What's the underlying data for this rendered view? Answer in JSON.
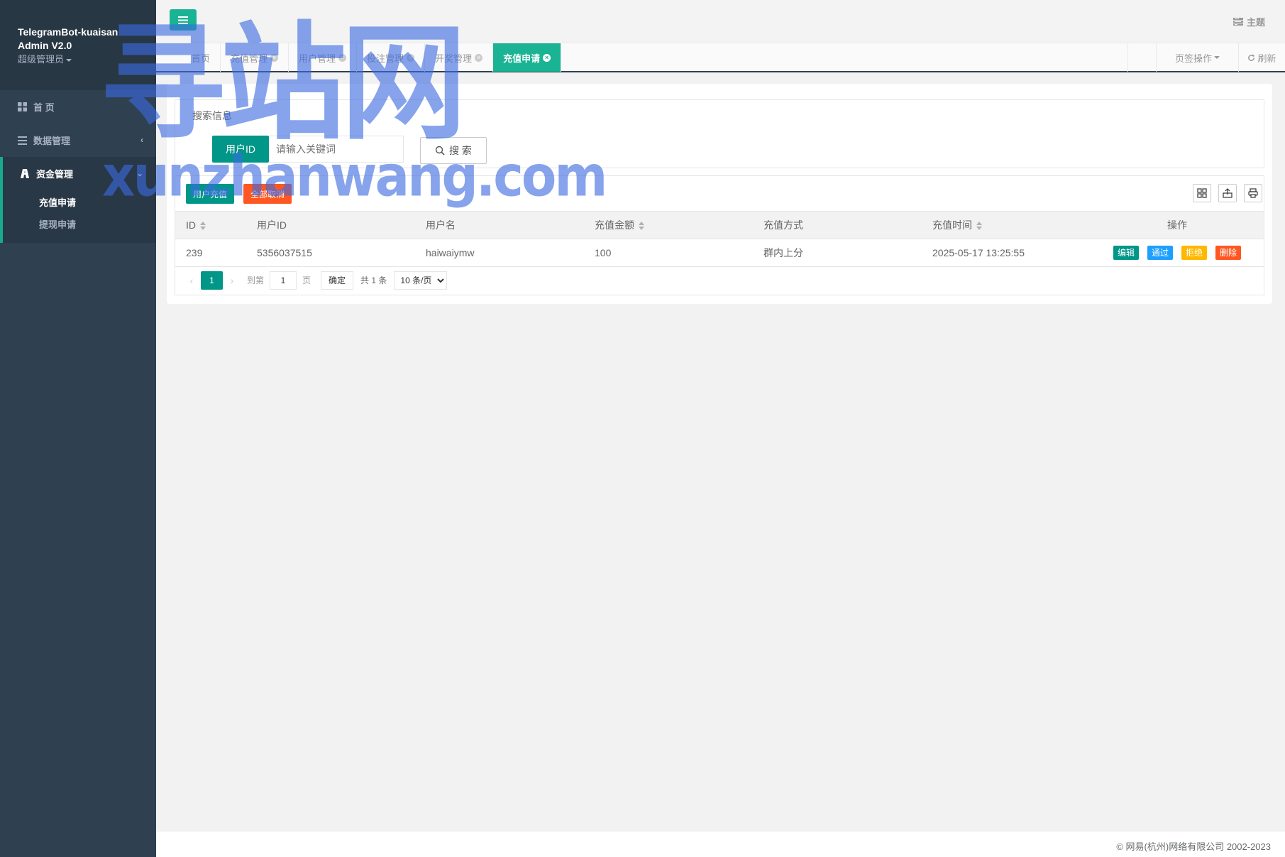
{
  "brand": {
    "title_line1": "TelegramBot-kuaisan",
    "title_line2": "Admin V2.0",
    "role": "超级管理员"
  },
  "sidebar": {
    "items": [
      {
        "label": "首 页"
      },
      {
        "label": "数据管理"
      },
      {
        "label": "资金管理"
      }
    ],
    "sub_items": [
      {
        "label": "充值申请",
        "active": true
      },
      {
        "label": "提现申请",
        "active": false
      }
    ]
  },
  "topbar": {
    "theme_label": "主题"
  },
  "tabs": [
    {
      "label": "首页",
      "closable": false
    },
    {
      "label": "充值管理",
      "closable": true
    },
    {
      "label": "用户管理",
      "closable": true
    },
    {
      "label": "投注管理",
      "closable": true
    },
    {
      "label": "开奖管理",
      "closable": true
    },
    {
      "label": "充值申请",
      "closable": true,
      "active": true
    }
  ],
  "tab_actions": {
    "ops_label": "页签操作",
    "refresh_label": "刷新"
  },
  "search": {
    "title": "搜索信息",
    "field_label": "用户ID",
    "placeholder": "请输入关键词",
    "button_label": "搜 索"
  },
  "toolbar": {
    "recharge_label": "用户充值",
    "cancel_all_label": "全部取消"
  },
  "table": {
    "columns": [
      "ID",
      "用户ID",
      "用户名",
      "充值金额",
      "充值方式",
      "充值时间",
      "操作"
    ],
    "rows": [
      {
        "id": "239",
        "user_id": "5356037515",
        "username": "haiwaiymw",
        "amount": "100",
        "method": "群内上分",
        "time": "2025-05-17 13:25:55"
      }
    ],
    "row_actions": {
      "edit": "编辑",
      "pass": "通过",
      "reject": "拒绝",
      "delete": "删除"
    }
  },
  "pager": {
    "current": "1",
    "goto_label": "到第",
    "goto_value": "1",
    "page_label": "页",
    "ok_label": "确定",
    "count_label": "共 1 条",
    "page_size": "10 条/页"
  },
  "footer": {
    "copyright": "© 网易(杭州)网络有限公司 2002-2023"
  },
  "watermark": {
    "big": "寻站网",
    "small": "xunzhanwang.com"
  },
  "colors": {
    "accent": "#1ab394",
    "sidebar": "#2f4050",
    "primary": "#009688",
    "danger": "#ff5722",
    "info": "#1e9fff",
    "warn": "#ffb800"
  }
}
